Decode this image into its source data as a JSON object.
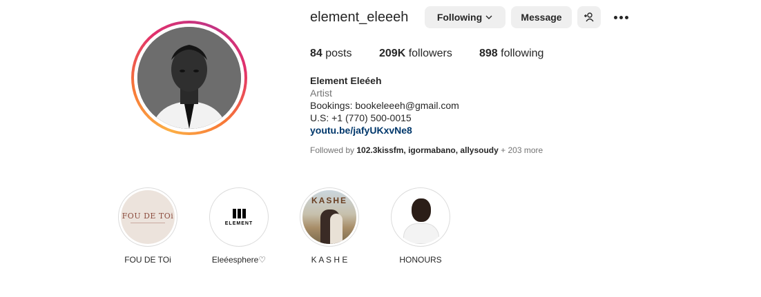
{
  "profile": {
    "username": "element_eleeeh",
    "following_button": "Following",
    "message_button": "Message",
    "stats": {
      "posts_count": "84",
      "posts_label": "posts",
      "followers_count": "209K",
      "followers_label": "followers",
      "following_count": "898",
      "following_label": "following"
    },
    "bio": {
      "name": "Element Eleéeh",
      "category": "Artist",
      "line1": "Bookings: bookeleeeh@gmail.com",
      "line2": "U.S: +1 (770) 500-0015",
      "link": "youtu.be/jafyUKxvNe8"
    },
    "followed_by": {
      "prefix": "Followed by",
      "names": "102.3kissfm, igormabano, allysoudy",
      "more": "+ 203 more"
    }
  },
  "highlights": [
    {
      "label": "FOU DE TOi",
      "cover_text": "FOU DE TOi"
    },
    {
      "label": "Eleéesphere♡",
      "cover_text": "ELEMENT"
    },
    {
      "label": "K A S H E",
      "cover_text": "KASHE"
    },
    {
      "label": "HONOURS"
    }
  ],
  "colors": {
    "button_bg": "#efefef",
    "link": "#00376b",
    "muted": "#737373",
    "ring_gradient": [
      "#fcaf45",
      "#f77737",
      "#e1306c",
      "#c13584"
    ]
  },
  "icons": [
    "chevron-down-icon",
    "add-person-icon",
    "more-options-icon"
  ]
}
